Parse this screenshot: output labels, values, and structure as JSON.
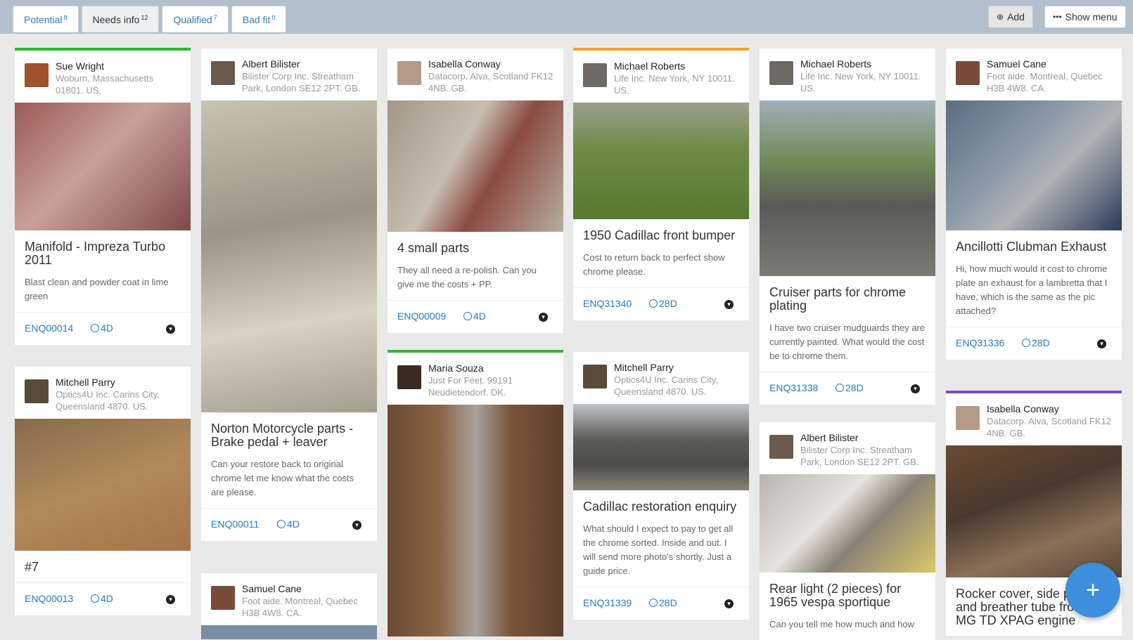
{
  "tabs": [
    {
      "label": "Potential",
      "count": "8"
    },
    {
      "label": "Needs info",
      "count": "12"
    },
    {
      "label": "Qualified",
      "count": "7"
    },
    {
      "label": "Bad fit",
      "count": "0"
    }
  ],
  "toolbar": {
    "add_label": "Add",
    "menu_label": "Show menu"
  },
  "fab_label": "+",
  "colors": {
    "green": "#2eb82e",
    "orange": "#f0a030",
    "purple": "#7b4fc9",
    "link": "#2b7bb9"
  },
  "cards": [
    {
      "name": "Sue Wright",
      "addr": "Woburn, Massachusetts 01801. US.",
      "title": "Manifold - Impreza Turbo 2011",
      "desc": "Blast clean and powder coat in lime green",
      "ref": "ENQ00014",
      "age": "4D"
    },
    {
      "name": "Mitchell Parry",
      "addr": "Optics4U Inc. Carins City, Queensland 4870. US.",
      "title": "#7",
      "desc": "",
      "ref": "ENQ00013",
      "age": "4D"
    },
    {
      "name": "Albert Bilister",
      "addr": "Bilister Corp Inc. Streatham Park, London SE12 2PT. GB.",
      "title": "Norton Motorcycle parts - Brake pedal + leaver",
      "desc": "Can your restore back to original chrome let me know what the costs are please.",
      "ref": "ENQ00011",
      "age": "4D"
    },
    {
      "name": "Samuel Cane",
      "addr": "Foot aide. Montreal, Quebec H3B 4W8. CA.",
      "title": "",
      "desc": "",
      "ref": "",
      "age": ""
    },
    {
      "name": "Isabella Conway",
      "addr": "Datacorp. Alva, Scotland FK12 4NB. GB.",
      "title": "4 small parts",
      "desc": "They all need a re-polish. Can you give me the costs + PP.",
      "ref": "ENQ00009",
      "age": "4D"
    },
    {
      "name": "Maria Souza",
      "addr": "Just For Feet. 99191 Neudietendorf. DK.",
      "title": "",
      "desc": "",
      "ref": "",
      "age": ""
    },
    {
      "name": "Michael Roberts",
      "addr": "Life Inc. New York, NY 10011. US.",
      "title": "1950 Cadillac front bumper",
      "desc": "Cost to return back to perfect show chrome please.",
      "ref": "ENQ31340",
      "age": "28D"
    },
    {
      "name": "Mitchell Parry",
      "addr": "Optics4U Inc. Carins City, Queensland 4870. US.",
      "title": "Cadillac restoration enquiry",
      "desc": "What should I expect to pay to get all the chrome sorted. Inside and out. I will send more photo's shortly. Just a guide price.",
      "ref": "ENQ31339",
      "age": "28D"
    },
    {
      "name": "Michael Roberts",
      "addr": "Life Inc. New York, NY 10011. US.",
      "title": "Cruiser parts for chrome plating",
      "desc": "I have two cruiser mudguards they are currently painted. What would the cost be to chrome them.",
      "ref": "ENQ31338",
      "age": "28D"
    },
    {
      "name": "Albert Bilister",
      "addr": "Bilister Corp Inc. Streatham Park, London SE12 2PT. GB.",
      "title": "Rear light (2 pieces) for 1965 vespa sportique",
      "desc": "Can you tell me how much and how",
      "ref": "",
      "age": ""
    },
    {
      "name": "Samuel Cane",
      "addr": "Foot aide. Montreal, Quebec H3B 4W8. CA.",
      "title": "Ancillotti Clubman Exhaust",
      "desc": "Hi, how much would it cost to chrome plate an exhaust for a lambretta that I have, which is the same as the pic attached?",
      "ref": "ENQ31336",
      "age": "28D"
    },
    {
      "name": "Isabella Conway",
      "addr": "Datacorp. Alva, Scotland FK12 4NB. GB.",
      "title": "Rocker cover, side plate and breather tube from an MG TD XPAG engine",
      "desc": "",
      "ref": "",
      "age": ""
    }
  ]
}
